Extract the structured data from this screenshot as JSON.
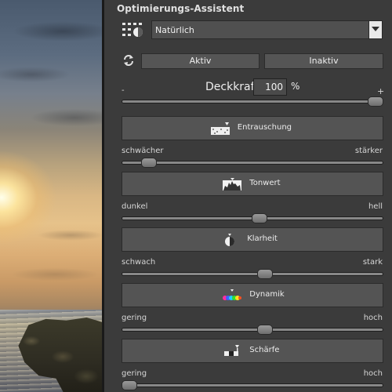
{
  "panel": {
    "title": "Optimierungs-Assistent",
    "preset": {
      "value": "Natürlich"
    },
    "buttons": {
      "active": "Aktiv",
      "inactive": "Inaktiv"
    },
    "opacity": {
      "label": "Deckkraft",
      "value": "100",
      "unit": "%",
      "min_symbol": "-",
      "max_symbol": "+",
      "level": 1.0
    },
    "sections": [
      {
        "label": "Entrauschung",
        "icon": "noise-icon",
        "low": "schwächer",
        "high": "stärker",
        "level": 0.08
      },
      {
        "label": "Tonwert",
        "icon": "histogram-icon",
        "low": "dunkel",
        "high": "hell",
        "level": 0.53
      },
      {
        "label": "Klarheit",
        "icon": "contrast-icon",
        "low": "schwach",
        "high": "stark",
        "level": 0.55
      },
      {
        "label": "Dynamik",
        "icon": "color-spectrum-icon",
        "low": "gering",
        "high": "hoch",
        "level": 0.55
      },
      {
        "label": "Schärfe",
        "icon": "sharpness-icon",
        "low": "gering",
        "high": "hoch",
        "level": 0.0
      }
    ]
  },
  "colors": {
    "panel": "#3b3b3b",
    "button": "#545454",
    "text": "#e0e0e0"
  }
}
